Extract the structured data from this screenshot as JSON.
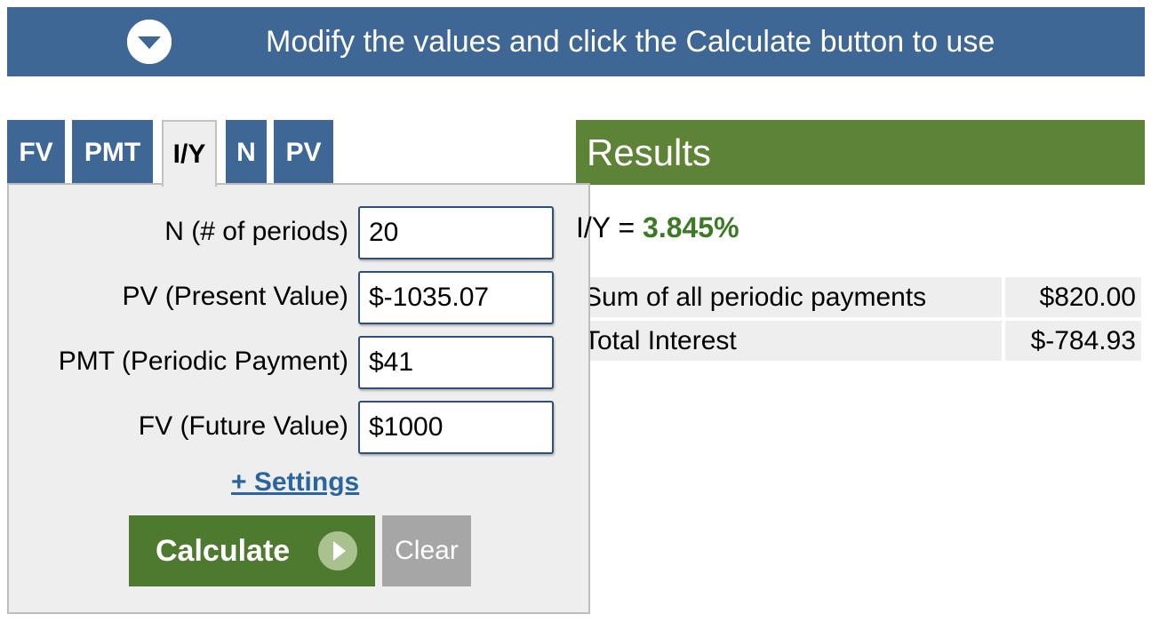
{
  "banner": {
    "text": "Modify the values and click the Calculate button to use"
  },
  "tabs": [
    {
      "label": "FV"
    },
    {
      "label": "PMT"
    },
    {
      "label": "I/Y"
    },
    {
      "label": "N"
    },
    {
      "label": "PV"
    }
  ],
  "active_tab": "I/Y",
  "form": {
    "n_label": "N (# of periods)",
    "n_value": "20",
    "pv_label": "PV (Present Value)",
    "pv_value": "$-1035.07",
    "pmt_label": "PMT (Periodic Payment)",
    "pmt_value": "$41",
    "fv_label": "FV (Future Value)",
    "fv_value": "$1000",
    "settings_link": "+ Settings",
    "calculate_label": "Calculate",
    "clear_label": "Clear"
  },
  "results": {
    "header": "Results",
    "result_prefix": "I/Y = ",
    "result_value": "3.845%",
    "rows": [
      {
        "label": "Sum of all periodic payments",
        "value": "$820.00"
      },
      {
        "label": "Total Interest",
        "value": "$-784.93"
      }
    ]
  },
  "colors": {
    "banner_blue": "#3e6796",
    "results_green": "#5d8436",
    "calculate_green": "#4e7a2f",
    "result_value_green": "#3c7a25",
    "link_blue": "#2a65a0"
  }
}
